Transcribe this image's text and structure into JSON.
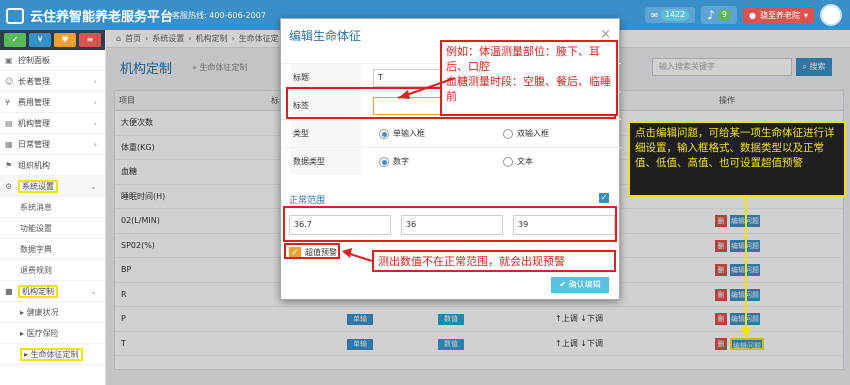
{
  "header": {
    "app_title": "云住养智能养老服务平台",
    "hotline": "客服热线: 400-606-2007",
    "count1": "1422",
    "count2": "9",
    "user_name": "骁至养老院"
  },
  "sidebar": {
    "tools": [
      "✓",
      "¥",
      "♥",
      "≡"
    ],
    "items": [
      {
        "label": "控制面板",
        "icon": "dashboard-icon"
      },
      {
        "label": "长者管理",
        "icon": "user-icon"
      },
      {
        "label": "费用管理",
        "icon": "money-icon"
      },
      {
        "label": "机构管理",
        "icon": "building-icon"
      },
      {
        "label": "日常管理",
        "icon": "calendar-icon"
      },
      {
        "label": "组织机构",
        "icon": "org-icon"
      },
      {
        "label": "系统设置",
        "icon": "gear-icon"
      },
      {
        "label": "系统消息",
        "icon": ""
      },
      {
        "label": "功能设置",
        "icon": ""
      },
      {
        "label": "数据字典",
        "icon": ""
      },
      {
        "label": "退费规则",
        "icon": ""
      },
      {
        "label": "机构定制",
        "icon": "settings-icon"
      },
      {
        "label": "健康状况",
        "icon": ""
      },
      {
        "label": "医疗保险",
        "icon": ""
      },
      {
        "label": "生命体征定制",
        "icon": ""
      }
    ]
  },
  "breadcrumb": [
    "首页",
    "系统设置",
    "机构定制",
    "生命体征定"
  ],
  "page": {
    "title": "机构定制",
    "subtitle": "生命体征定制",
    "search_placeholder": "输入搜索关键字",
    "search_button": "搜索"
  },
  "table": {
    "headers": [
      "项目",
      "标",
      "操作"
    ],
    "rows": [
      {
        "name": "大便次数"
      },
      {
        "name": "体重(KG)"
      },
      {
        "name": "血糖"
      },
      {
        "name": "睡眠时间(H)"
      },
      {
        "name": "02(L/MIN)"
      },
      {
        "name": "SP02(%)"
      },
      {
        "name": "BP"
      },
      {
        "name": "R"
      },
      {
        "name": "P",
        "type": "单输",
        "dtype": "数值",
        "order": "↑上调 ↓下调"
      },
      {
        "name": "T",
        "type": "单输",
        "dtype": "数值",
        "order": "↑上调 ↓下调"
      }
    ],
    "delete_label": "删",
    "edit_label": "编辑问题"
  },
  "modal": {
    "title": "编辑生命体征",
    "fields": {
      "title_label": "标题",
      "title_value": "T",
      "tip_label": "标签",
      "tip_value": "",
      "type_label": "类型",
      "type_single": "单输入框",
      "type_double": "双输入框",
      "dtype_label": "数据类型",
      "dtype_num": "数字",
      "dtype_text": "文本"
    },
    "range_title": "正常范围",
    "range_values": [
      "36.7",
      "36",
      "39"
    ],
    "warning_label": "超值预警",
    "confirm_label": "确认编辑"
  },
  "annotations": {
    "example": "例如：体温测量部位：腋下、耳后、口腔\n血糖测量时段：空腹、餐后、临睡前",
    "edit_help": "点击编辑问题，可给某一项生命体征进行详细设置，输入框格式、数据类型以及正常值、低值、高值、也可设置超值预警",
    "warning_help": "测出数值不在正常范围，就会出现预警"
  },
  "colors": {
    "brand": "#3b8fc8",
    "annotation_red": "#e02020",
    "annotation_yellow": "#f2e300"
  }
}
